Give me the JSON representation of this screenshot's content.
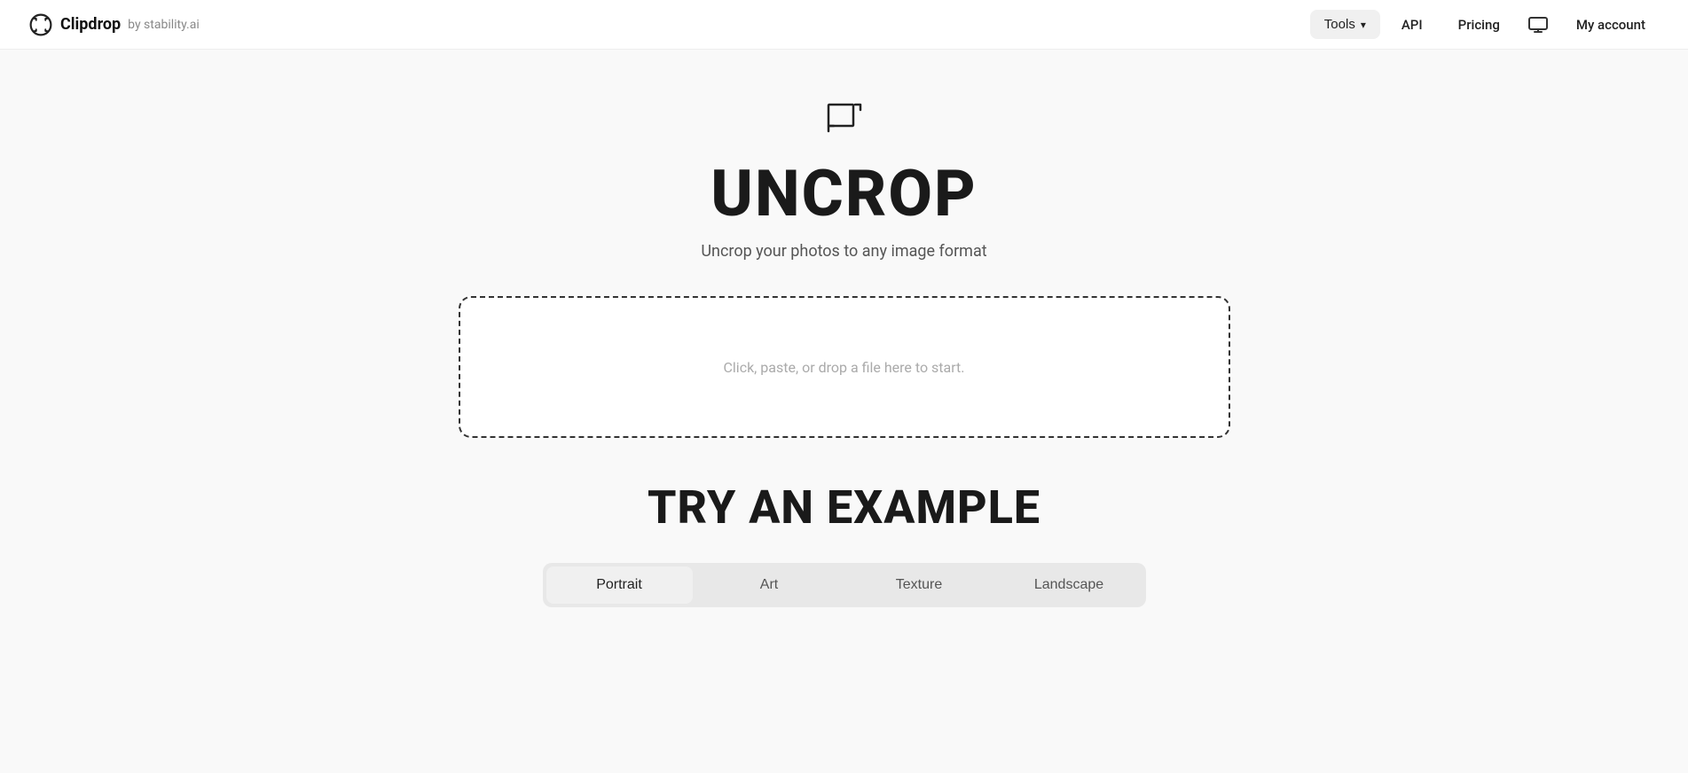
{
  "header": {
    "logo_brand": "Clipdrop",
    "logo_suffix": "by stability.ai",
    "nav": {
      "tools_label": "Tools",
      "api_label": "API",
      "pricing_label": "Pricing",
      "account_label": "My account"
    }
  },
  "hero": {
    "icon_label": "uncrop-tool-icon",
    "title": "UNCROP",
    "subtitle": "Uncrop your photos to any image format"
  },
  "drop_zone": {
    "placeholder": "Click, paste, or drop a file here to start."
  },
  "examples": {
    "section_title": "TRY AN EXAMPLE",
    "tabs": [
      {
        "label": "Portrait",
        "active": true
      },
      {
        "label": "Art",
        "active": false
      },
      {
        "label": "Texture",
        "active": false
      },
      {
        "label": "Landscape",
        "active": false
      }
    ]
  }
}
